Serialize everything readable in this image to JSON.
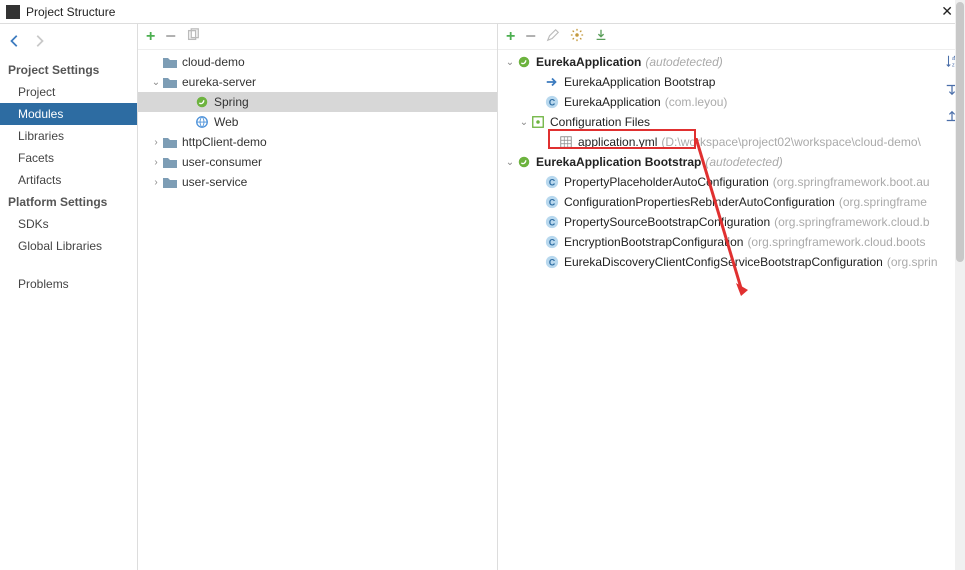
{
  "window": {
    "title": "Project Structure"
  },
  "sidebar": {
    "section1": "Project Settings",
    "items1": [
      "Project",
      "Modules",
      "Libraries",
      "Facets",
      "Artifacts"
    ],
    "section2": "Platform Settings",
    "items2": [
      "SDKs",
      "Global Libraries"
    ],
    "items3": [
      "Problems"
    ]
  },
  "modulesTree": [
    {
      "indent": 0,
      "twist": "",
      "icon": "folder",
      "label": "cloud-demo"
    },
    {
      "indent": 0,
      "twist": "v",
      "icon": "folder",
      "label": "eureka-server"
    },
    {
      "indent": 2,
      "twist": "",
      "icon": "spring",
      "label": "Spring",
      "selected": true
    },
    {
      "indent": 2,
      "twist": "",
      "icon": "web",
      "label": "Web"
    },
    {
      "indent": 0,
      "twist": ">",
      "icon": "folder",
      "label": "httpClient-demo"
    },
    {
      "indent": 0,
      "twist": ">",
      "icon": "folder",
      "label": "user-consumer"
    },
    {
      "indent": 0,
      "twist": ">",
      "icon": "folder",
      "label": "user-service"
    }
  ],
  "rightTree": [
    {
      "indent": 0,
      "twist": "v",
      "icon": "spring",
      "bold": true,
      "label": "EurekaApplication",
      "hint": "(autodetected)"
    },
    {
      "indent": 2,
      "twist": "",
      "icon": "arrow-blue",
      "label": "EurekaApplication Bootstrap",
      "hint": ""
    },
    {
      "indent": 2,
      "twist": "",
      "icon": "c-blue",
      "label": "EurekaApplication",
      "hint": "(com.leyou)"
    },
    {
      "indent": 1,
      "twist": "v",
      "icon": "config",
      "label": "Configuration Files",
      "hint": ""
    },
    {
      "indent": 3,
      "twist": "",
      "icon": "grid",
      "label": "application.yml",
      "hint": "(D:\\workspace\\project02\\workspace\\cloud-demo\\",
      "highlighted": true
    },
    {
      "indent": 0,
      "twist": "v",
      "icon": "spring",
      "bold": true,
      "label": "EurekaApplication Bootstrap",
      "hint": "(autodetected)"
    },
    {
      "indent": 2,
      "twist": "",
      "icon": "c-blue",
      "label": "PropertyPlaceholderAutoConfiguration",
      "hint": "(org.springframework.boot.au"
    },
    {
      "indent": 2,
      "twist": "",
      "icon": "c-blue",
      "label": "ConfigurationPropertiesRebinderAutoConfiguration",
      "hint": "(org.springframe"
    },
    {
      "indent": 2,
      "twist": "",
      "icon": "c-blue",
      "label": "PropertySourceBootstrapConfiguration",
      "hint": "(org.springframework.cloud.b"
    },
    {
      "indent": 2,
      "twist": "",
      "icon": "c-blue",
      "label": "EncryptionBootstrapConfiguration",
      "hint": "(org.springframework.cloud.boots"
    },
    {
      "indent": 2,
      "twist": "",
      "icon": "c-blue",
      "label": "EurekaDiscoveryClientConfigServiceBootstrapConfiguration",
      "hint": "(org.sprin"
    }
  ]
}
